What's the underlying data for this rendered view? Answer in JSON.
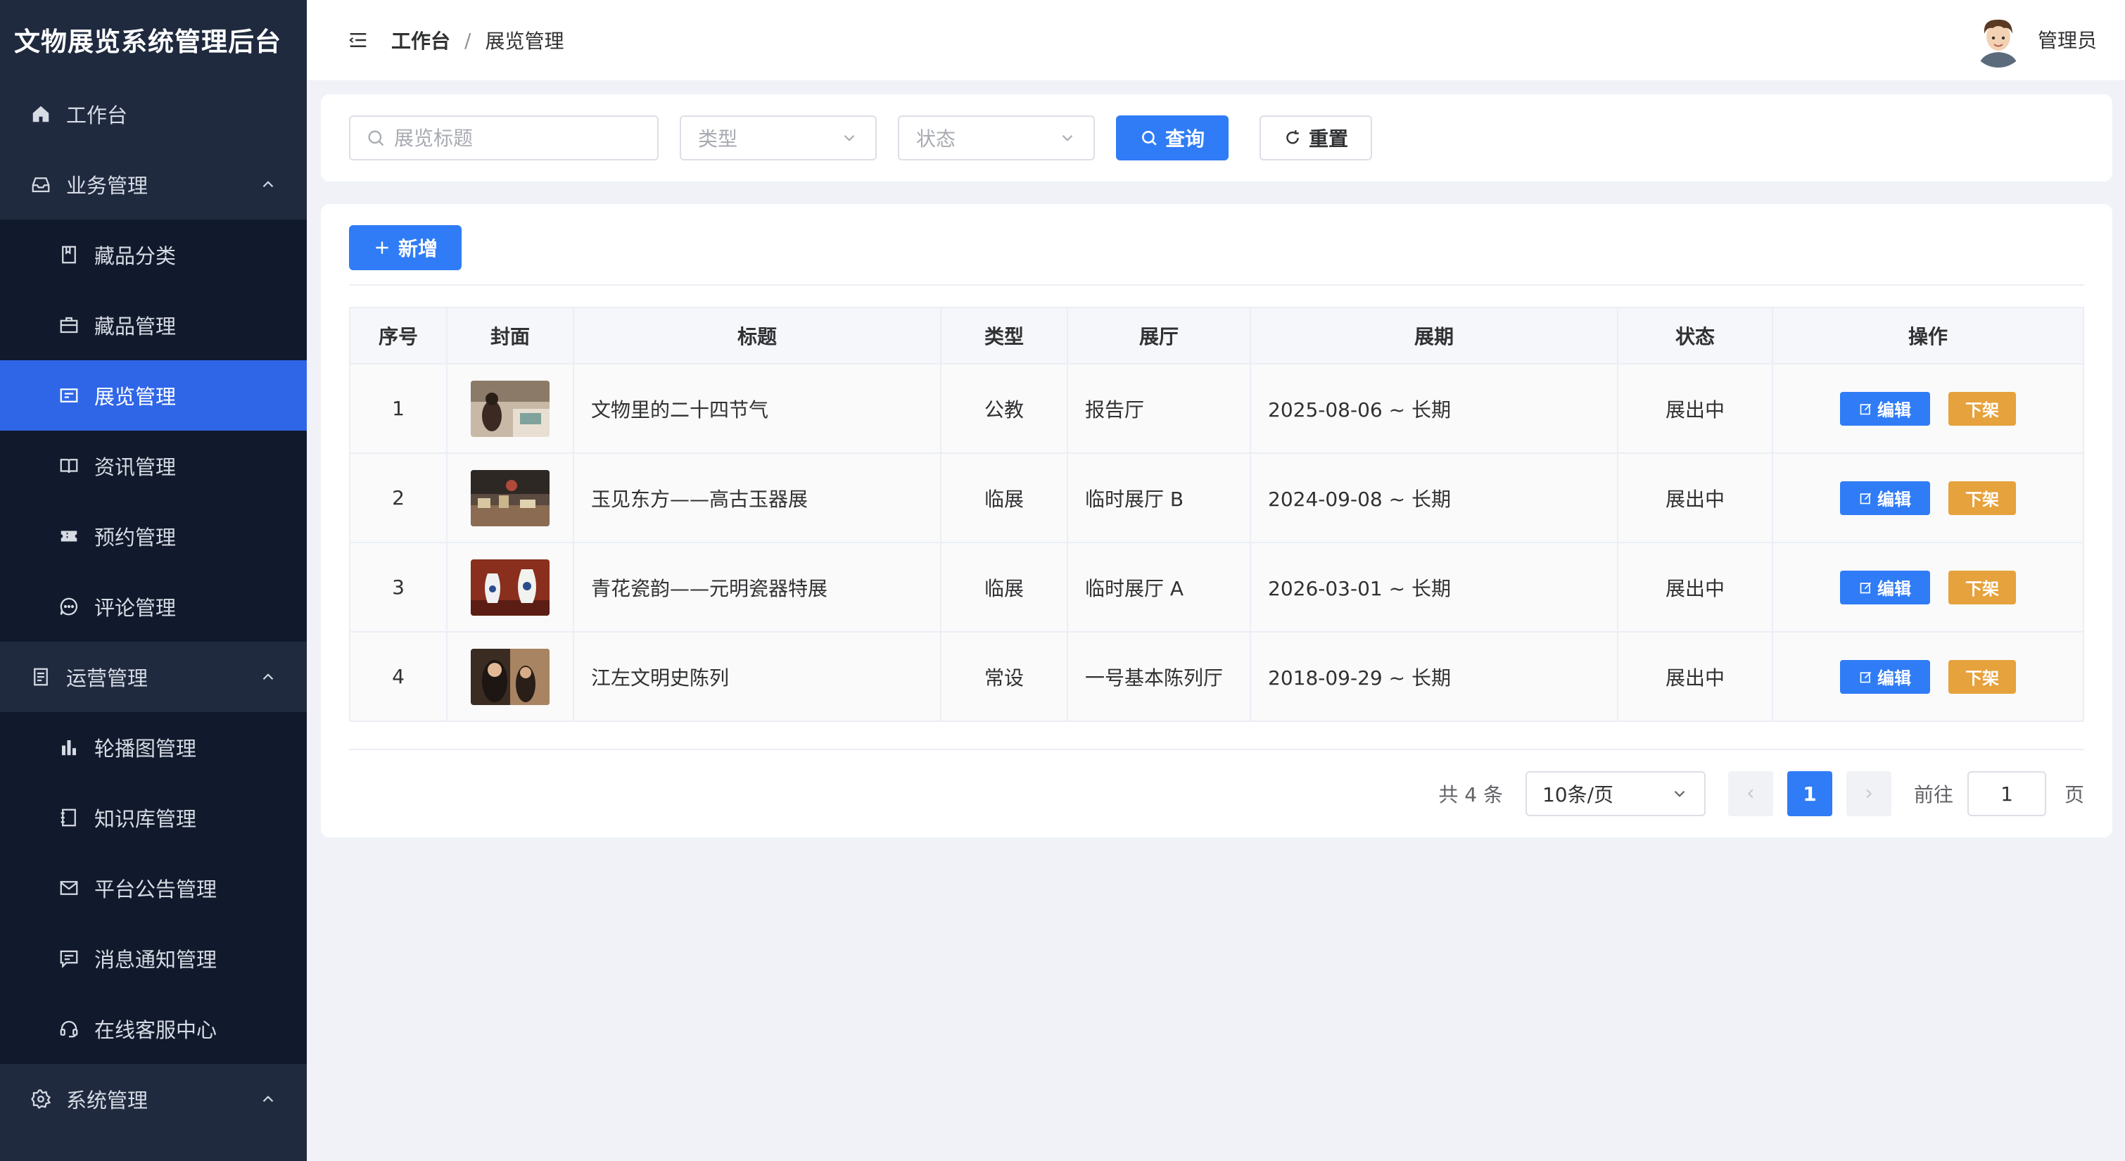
{
  "app": {
    "title": "文物展览系统管理后台"
  },
  "sidebar": {
    "items": [
      {
        "label": "工作台",
        "icon": "home-icon",
        "level": 1
      },
      {
        "label": "业务管理",
        "icon": "inbox-icon",
        "level": 1,
        "expanded": true
      },
      {
        "label": "藏品分类",
        "icon": "book-icon",
        "level": 2
      },
      {
        "label": "藏品管理",
        "icon": "briefcase-icon",
        "level": 2
      },
      {
        "label": "展览管理",
        "icon": "card-icon",
        "level": 2,
        "active": true
      },
      {
        "label": "资讯管理",
        "icon": "open-book-icon",
        "level": 2
      },
      {
        "label": "预约管理",
        "icon": "ticket-icon",
        "level": 2
      },
      {
        "label": "评论管理",
        "icon": "chat-bubble-icon",
        "level": 2
      },
      {
        "label": "运营管理",
        "icon": "document-icon",
        "level": 1,
        "expanded": true
      },
      {
        "label": "轮播图管理",
        "icon": "bar-chart-icon",
        "level": 2
      },
      {
        "label": "知识库管理",
        "icon": "notebook-icon",
        "level": 2
      },
      {
        "label": "平台公告管理",
        "icon": "mail-icon",
        "level": 2
      },
      {
        "label": "消息通知管理",
        "icon": "message-icon",
        "level": 2
      },
      {
        "label": "在线客服中心",
        "icon": "headset-icon",
        "level": 2
      },
      {
        "label": "系统管理",
        "icon": "gear-icon",
        "level": 1,
        "expanded": true
      }
    ]
  },
  "header": {
    "breadcrumb_home": "工作台",
    "breadcrumb_sep": "/",
    "breadcrumb_current": "展览管理",
    "user_name": "管理员"
  },
  "search": {
    "title_placeholder": "展览标题",
    "type_placeholder": "类型",
    "status_placeholder": "状态",
    "query_label": "查询",
    "reset_label": "重置"
  },
  "toolbar": {
    "add_label": "新增"
  },
  "table": {
    "columns": [
      "序号",
      "封面",
      "标题",
      "类型",
      "展厅",
      "展期",
      "状态",
      "操作"
    ],
    "rows": [
      {
        "index": "1",
        "title": "文物里的二十四节气",
        "type": "公教",
        "hall": "报告厅",
        "period": "2025-08-06 ~ 长期",
        "status": "展出中"
      },
      {
        "index": "2",
        "title": "玉见东方——高古玉器展",
        "type": "临展",
        "hall": "临时展厅 B",
        "period": "2024-09-08 ~ 长期",
        "status": "展出中"
      },
      {
        "index": "3",
        "title": "青花瓷韵——元明瓷器特展",
        "type": "临展",
        "hall": "临时展厅 A",
        "period": "2026-03-01 ~ 长期",
        "status": "展出中"
      },
      {
        "index": "4",
        "title": "江左文明史陈列",
        "type": "常设",
        "hall": "一号基本陈列厅",
        "period": "2018-09-29 ~ 长期",
        "status": "展出中"
      }
    ],
    "edit_label": "编辑",
    "offline_label": "下架"
  },
  "pagination": {
    "total_text": "共 4 条",
    "page_size": "10条/页",
    "current_page": "1",
    "goto_label": "前往",
    "goto_value": "1",
    "page_unit": "页"
  },
  "colors": {
    "sidebar_bg": "#1f2a3f",
    "sidebar_sub_bg": "#111a2c",
    "active": "#2f66e8",
    "primary": "#2f7cf6",
    "warning": "#e6a23c"
  }
}
